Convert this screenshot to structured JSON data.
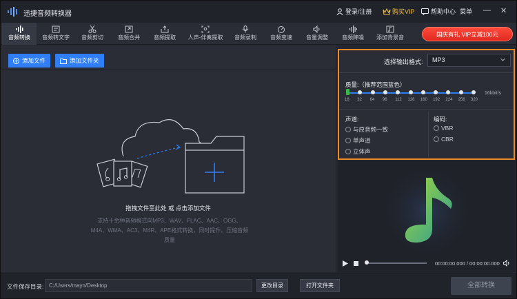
{
  "app": {
    "title": "迅捷音频转换器",
    "login_label": "登录/注册",
    "buy_vip_label": "购买VIP",
    "help_label": "帮助中心",
    "menu_label": "菜单",
    "minimize_glyph": "—",
    "close_glyph": "✕"
  },
  "toolbar": {
    "items": [
      {
        "label": "音频转换",
        "icon": "audio-convert-icon",
        "active": true
      },
      {
        "label": "音频转文字",
        "icon": "audio-to-text-icon"
      },
      {
        "label": "音频剪切",
        "icon": "scissors-icon"
      },
      {
        "label": "音频合并",
        "icon": "merge-icon"
      },
      {
        "label": "音频提取",
        "icon": "extract-icon"
      },
      {
        "label": "人声-伴奏提取",
        "icon": "vocal-extract-icon"
      },
      {
        "label": "音频录制",
        "icon": "microphone-icon"
      },
      {
        "label": "音频变速",
        "icon": "speed-icon"
      },
      {
        "label": "音量调整",
        "icon": "volume-icon"
      },
      {
        "label": "音频降噪",
        "icon": "denoise-icon"
      },
      {
        "label": "添加背景音",
        "icon": "add-music-icon"
      }
    ],
    "promo_label": "国庆有礼 VIP立减100元"
  },
  "left": {
    "add_file_label": "添加文件",
    "add_folder_label": "添加文件夹",
    "drop_title": "拖拽文件至此处 或 点击添加文件",
    "drop_desc": "支持十余种音频格式向MP3、WAV、FLAC、AAC、OGG、M4A、WMA、AC3、M4R、APE格式转换，同时提升、压缩音频质量"
  },
  "right": {
    "format_label": "选择输出格式:",
    "format_value": "MP3",
    "quality_label": "质量:（推荐范围蓝色）",
    "quality_ticks": [
      "16",
      "32",
      "64",
      "96",
      "112",
      "128",
      "160",
      "192",
      "224",
      "256",
      "320"
    ],
    "quality_unit": "16kbit/s",
    "channel_label": "声道:",
    "channel_options": [
      "与原音频一致",
      "单声道",
      "立体声"
    ],
    "encoding_label": "编码:",
    "encoding_options": [
      "VBR",
      "CBR"
    ]
  },
  "player": {
    "time_display": "00:00:00.000 / 00:00:00.000"
  },
  "bottom": {
    "save_dir_label": "文件保存目录:",
    "save_dir_value": "C:/Users/mayn/Desktop",
    "change_dir_label": "更改目录",
    "open_folder_label": "打开文件夹",
    "convert_all_label": "全部转换"
  },
  "colors": {
    "accent_blue": "#2f7ef5",
    "highlight_orange": "#f08a24",
    "promo_red": "#e02a20",
    "note_green": "#8fcf3c"
  }
}
